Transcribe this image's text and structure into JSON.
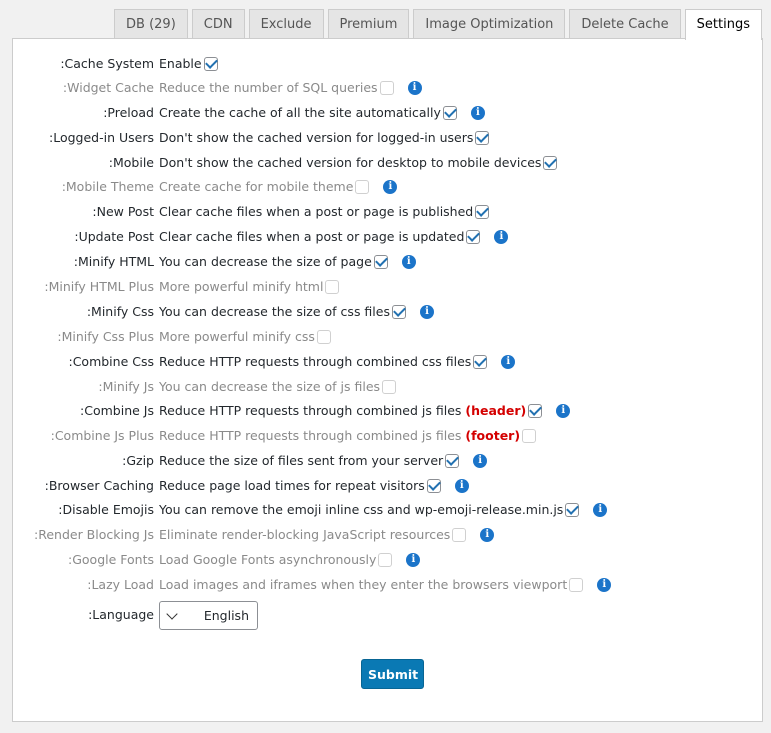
{
  "tabs": [
    "Settings",
    "Delete Cache",
    "Image Optimization",
    "Premium",
    "Exclude",
    "CDN",
    "DB (29)"
  ],
  "rows": [
    {
      "label": ":Cache System",
      "text": "Enable",
      "checked": true,
      "dim": false,
      "info": false
    },
    {
      "label": ":Widget Cache",
      "text": "Reduce the number of SQL queries",
      "checked": false,
      "dim": true,
      "info": true
    },
    {
      "label": ":Preload",
      "text": "Create the cache of all the site automatically",
      "checked": true,
      "dim": false,
      "info": true
    },
    {
      "label": ":Logged-in Users",
      "text": "Don't show the cached version for logged-in users",
      "checked": true,
      "dim": false,
      "info": false
    },
    {
      "label": ":Mobile",
      "text": "Don't show the cached version for desktop to mobile devices",
      "checked": true,
      "dim": false,
      "info": false
    },
    {
      "label": ":Mobile Theme",
      "text": "Create cache for mobile theme",
      "checked": false,
      "dim": true,
      "info": true
    },
    {
      "label": ":New Post",
      "text": "Clear cache files when a post or page is published",
      "checked": true,
      "dim": false,
      "info": false
    },
    {
      "label": ":Update Post",
      "text": "Clear cache files when a post or page is updated",
      "checked": true,
      "dim": false,
      "info": true
    },
    {
      "label": ":Minify HTML",
      "text": "You can decrease the size of page",
      "checked": true,
      "dim": false,
      "info": true
    },
    {
      "label": ":Minify HTML Plus",
      "text": "More powerful minify html",
      "checked": false,
      "dim": true,
      "info": false
    },
    {
      "label": ":Minify Css",
      "text": "You can decrease the size of css files",
      "checked": true,
      "dim": false,
      "info": true
    },
    {
      "label": ":Minify Css Plus",
      "text": "More powerful minify css",
      "checked": false,
      "dim": true,
      "info": false
    },
    {
      "label": ":Combine Css",
      "text": "Reduce HTTP requests through combined css files",
      "checked": true,
      "dim": false,
      "info": true
    },
    {
      "label": ":Minify Js",
      "text": "You can decrease the size of js files",
      "checked": false,
      "dim": true,
      "info": false
    },
    {
      "label": ":Combine Js",
      "text": "Reduce HTTP requests through combined js files",
      "extra": "(header)",
      "checked": true,
      "dim": false,
      "info": true
    },
    {
      "label": ":Combine Js Plus",
      "text": "Reduce HTTP requests through combined js files",
      "extra": "(footer)",
      "checked": false,
      "dim": true,
      "info": false
    },
    {
      "label": ":Gzip",
      "text": "Reduce the size of files sent from your server",
      "checked": true,
      "dim": false,
      "info": true
    },
    {
      "label": ":Browser Caching",
      "text": "Reduce page load times for repeat visitors",
      "checked": true,
      "dim": false,
      "info": true
    },
    {
      "label": ":Disable Emojis",
      "text": "You can remove the emoji inline css and wp-emoji-release.min.js",
      "checked": true,
      "dim": false,
      "info": true
    },
    {
      "label": ":Render Blocking Js",
      "text": "Eliminate render-blocking JavaScript resources",
      "checked": false,
      "dim": true,
      "info": true
    },
    {
      "label": ":Google Fonts",
      "text": "Load Google Fonts asynchronously",
      "checked": false,
      "dim": true,
      "info": true
    },
    {
      "label": ":Lazy Load",
      "text": "Load images and iframes when they enter the browsers viewport",
      "checked": false,
      "dim": true,
      "info": true
    }
  ],
  "language": {
    "label": ":Language",
    "value": "English"
  },
  "submit_label": "Submit",
  "info_glyph": "i",
  "colors": {
    "accent": "#2271b1",
    "button": "#0a79b4",
    "info": "#1b74c9",
    "red": "#d40000"
  }
}
